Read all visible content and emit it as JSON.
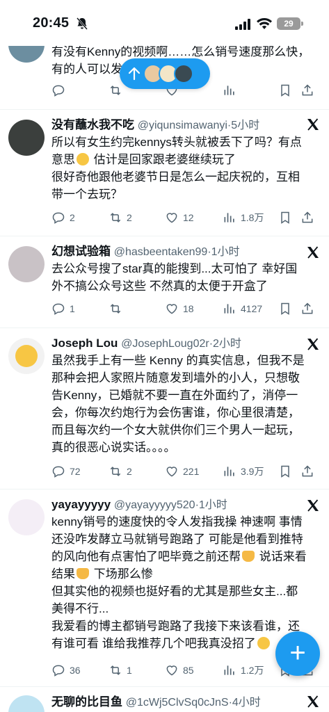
{
  "status_bar": {
    "time": "20:45",
    "battery": "29"
  },
  "top_tweet_partial": {
    "text": "有没有Kenny的视频啊……怎么销号速度那么快，\n有的人可以发"
  },
  "tweets": [
    {
      "name": "没有蘸水我不吃",
      "handle": "@yiqunsimawanyi",
      "time": "·5小时",
      "text_a": "所以有女生约完kennys转头就被丢下了吗？有点\n意思",
      "text_b": " 估计是回家跟老婆继续玩了\n很好奇他跟他老婆节日是怎么一起庆祝的，互相\n带一个去玩？",
      "replies": "2",
      "retweets": "2",
      "likes": "12",
      "views": "1.8万"
    },
    {
      "name": "幻想试验箱",
      "handle": "@hasbeentaken99",
      "time": "·1小时",
      "text": "去公众号搜了star真的能搜到...太可怕了 幸好国\n外不搞公众号这些 不然真的太便于开盒了",
      "replies": "1",
      "retweets": "",
      "likes": "18",
      "views": "4127"
    },
    {
      "name": "Joseph Lou",
      "handle": "@JosephLoug02r",
      "time": "·2小时",
      "text": "虽然我手上有一些 Kenny 的真实信息，但我不是\n那种会把人家照片随意发到墙外的小人，只想敬\n告Kenny，已婚就不要一直在外面约了，消停一\n会，你每次约炮行为会伤害谁，你心里很清楚，\n而且每次约一个女大就供你们三个男人一起玩，\n真的很恶心说实话。。。。",
      "replies": "72",
      "retweets": "2",
      "likes": "221",
      "views": "3.9万"
    },
    {
      "name": "yayayyyyy",
      "handle": "@yayayyyyy520",
      "time": "·1小时",
      "text_a": "kenny销号的速度快的令人发指我操 神速啊 事情\n还没咋发酵立马就销号跑路了 可能是他看到推特\n的风向他有点害怕了吧毕竟之前还帮",
      "text_b": " 说话来看\n结果",
      "text_c": " 下场那么惨\n但其实他的视频也挺好看的尤其是那些女主...都\n美得不行...\n我爱看的博主都销号跑路了我接下来该看谁，还\n有谁可看 谁给我推荐几个吧我真没招了",
      "replies": "36",
      "retweets": "1",
      "likes": "85",
      "views": "1.2万"
    },
    {
      "name": "无聊的比目鱼",
      "handle": "@1cWj5ClvSq0cJnS",
      "time": "·4小时"
    }
  ],
  "icons": {
    "reply": "speech-bubble-icon",
    "retweet": "retweet-arrows-icon",
    "like": "heart-icon",
    "views": "bar-chart-icon",
    "bookmark": "bookmark-icon",
    "share": "share-upload-icon",
    "x": "x-logo-icon",
    "compose": "plus-icon"
  },
  "colors": {
    "accent": "#1d9bf0",
    "text": "#0f1419",
    "muted": "#536471",
    "divider": "#eff3f4"
  },
  "fab_label": "+"
}
